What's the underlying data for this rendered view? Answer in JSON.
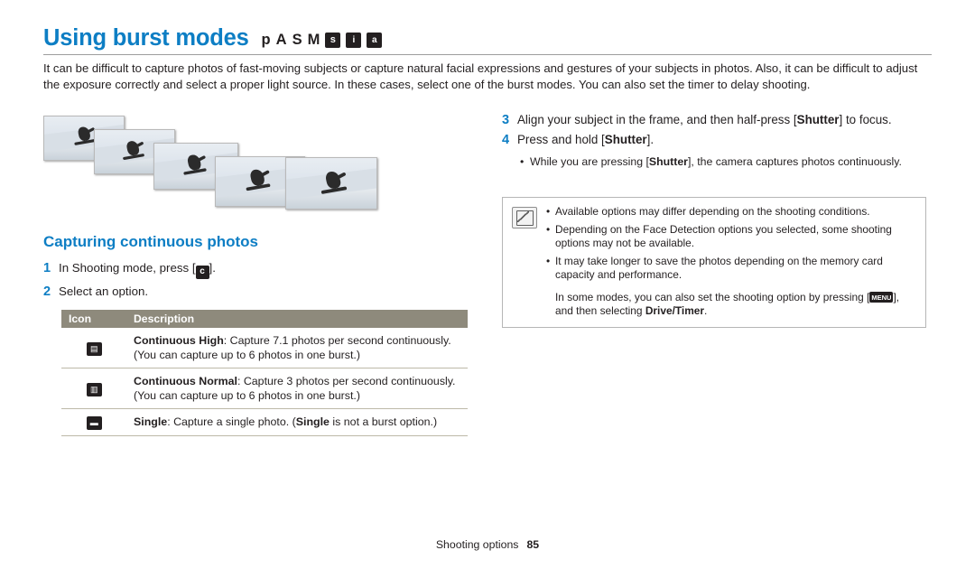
{
  "header": {
    "title": "Using burst modes",
    "mode_icons": [
      {
        "type": "letter",
        "label": "p"
      },
      {
        "type": "letter",
        "label": "A"
      },
      {
        "type": "letter",
        "label": "S"
      },
      {
        "type": "letter",
        "label": "M"
      },
      {
        "type": "box",
        "label": "s",
        "name": "smart-mode-icon"
      },
      {
        "type": "box",
        "label": "i",
        "name": "scene-mode-icon"
      },
      {
        "type": "box",
        "label": "a",
        "name": "auto-mode-icon"
      }
    ],
    "intro": "It can be difficult to capture photos of fast-moving subjects or capture natural facial expressions and gestures of your subjects in photos. Also, it can be difficult to adjust the exposure correctly and select a proper light source. In these cases, select one of the burst modes. You can also set the timer to delay shooting."
  },
  "left": {
    "section_heading": "Capturing continuous photos",
    "steps": [
      {
        "num": "1",
        "pre": "In Shooting mode, press [",
        "icon": "c",
        "post": "].",
        "icon_name": "drive-mode-icon"
      },
      {
        "num": "2",
        "pre": "Select an option.",
        "icon": "",
        "post": "",
        "icon_name": ""
      }
    ],
    "table": {
      "columns": [
        "Icon",
        "Description"
      ],
      "rows": [
        {
          "icon_glyph": "▤",
          "icon_name": "continuous-high-icon",
          "bold": "Continuous High",
          "text": ": Capture 7.1 photos per second continuously.",
          "note": "(You can capture up to 6 photos in one burst.)"
        },
        {
          "icon_glyph": "▥",
          "icon_name": "continuous-normal-icon",
          "bold": "Continuous Normal",
          "text": ": Capture 3 photos per second continuously.",
          "note": "(You can capture up to 6 photos in one burst.)"
        },
        {
          "icon_glyph": "▬",
          "icon_name": "single-shot-icon",
          "bold": "Single",
          "text": ": Capture a single photo. (",
          "bold2": "Single",
          "text2": " is not a burst option.)",
          "note": ""
        }
      ]
    }
  },
  "right": {
    "steps": [
      {
        "num": "3",
        "part1": "Align your subject in the frame, and then half-press [",
        "bold": "Shutter",
        "part2": "] to focus."
      },
      {
        "num": "4",
        "part1": "Press and hold [",
        "bold": "Shutter",
        "part2": "]."
      }
    ],
    "bullet": {
      "dot": "•",
      "part1": "While you are pressing [",
      "bold": "Shutter",
      "part2": "], the camera captures photos continuously."
    },
    "note_box": {
      "items": [
        {
          "dot": "•",
          "text": "Available options may differ depending on the shooting conditions."
        },
        {
          "dot": "•",
          "text": "Depending on the Face Detection options you selected, some shooting options may not be available."
        },
        {
          "dot": "•",
          "text": "It may take longer to save the photos depending on the memory card capacity and performance."
        }
      ],
      "last": {
        "part1": "In some modes, you can also set the shooting option by pressing [",
        "icon": "MENU",
        "icon_name": "menu-button-icon",
        "part2": "], and then selecting ",
        "bold": "Drive/Timer",
        "part3": "."
      }
    }
  },
  "footer": {
    "label": "Shooting options",
    "page_number": "85"
  },
  "colors": {
    "accent": "#0d7ec4",
    "table_header": "#8e8a7c",
    "text": "#231f20"
  }
}
